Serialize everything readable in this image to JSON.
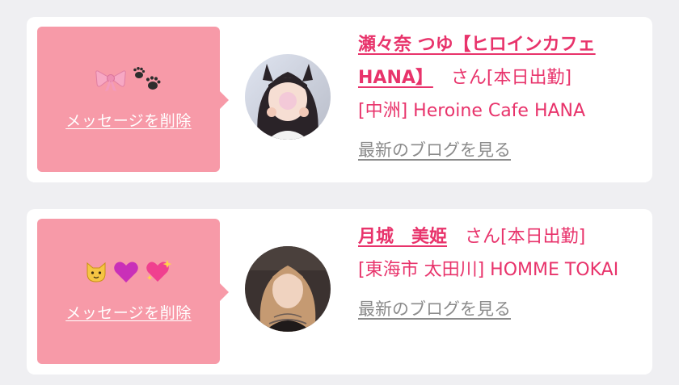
{
  "favorites": [
    {
      "emoji_icons": [
        "ribbon-icon",
        "paw-prints-icon"
      ],
      "delete_label": "メッセージを削除",
      "name": "瀬々奈 つゆ【ヒロインカフェ HANA】",
      "honorific": "さん",
      "status": "[本日出勤]",
      "shop": "[中洲] Heroine Cafe HANA",
      "blog_label": "最新のブログを見る"
    },
    {
      "emoji_icons": [
        "cat-face-icon",
        "purple-heart-icon",
        "sparkling-heart-icon"
      ],
      "delete_label": "メッセージを削除",
      "name": "月城　美姫",
      "honorific": "さん",
      "status": "[本日出勤]",
      "shop": "[東海市 太田川] HOMME TOKAI",
      "blog_label": "最新のブログを見る"
    }
  ],
  "colors": {
    "page_bg": "#efeff2",
    "card_bg": "#ffffff",
    "message_box": "#f79aa8",
    "accent_pink": "#e8336b",
    "link_gray": "#8b8b8b"
  }
}
